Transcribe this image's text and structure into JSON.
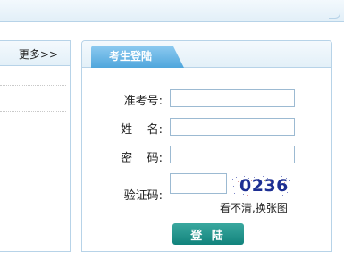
{
  "left_panel": {
    "more_label": "更多>>"
  },
  "login": {
    "tab_title": "考生登陆",
    "fields": {
      "exam_no_label": "准考号:",
      "name_label": "姓    名:",
      "password_label": "密    码:",
      "captcha_label": "验证码:"
    },
    "captcha_code": "0236",
    "refresh_captcha_label": "看不清,换张图",
    "submit_label": "登 陆"
  }
}
